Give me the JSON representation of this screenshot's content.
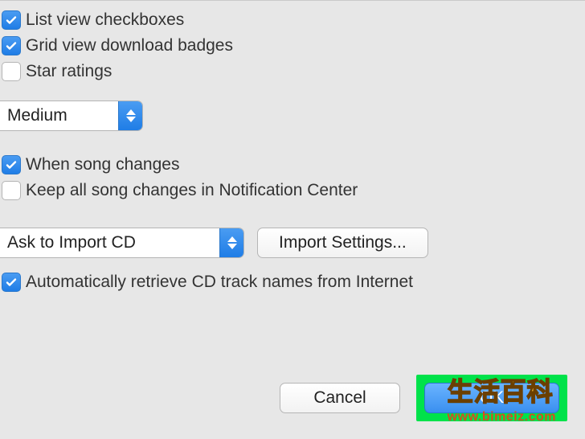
{
  "checkboxes": {
    "list_view": {
      "label": "List view checkboxes",
      "checked": true
    },
    "grid_view": {
      "label": "Grid view download badges",
      "checked": true
    },
    "star_ratings": {
      "label": "Star ratings",
      "checked": false
    },
    "song_changes": {
      "label": "When song changes",
      "checked": true
    },
    "keep_notifications": {
      "label": "Keep all song changes in Notification Center",
      "checked": false
    },
    "auto_retrieve": {
      "label": "Automatically retrieve CD track names from Internet",
      "checked": true
    }
  },
  "selects": {
    "size": {
      "value": "Medium"
    },
    "cd_action": {
      "value": "Ask to Import CD"
    }
  },
  "buttons": {
    "import_settings": "Import Settings...",
    "cancel": "Cancel",
    "ok": "OK"
  },
  "watermark": {
    "title": "生活百科",
    "url": "www.bimeiz.com"
  }
}
